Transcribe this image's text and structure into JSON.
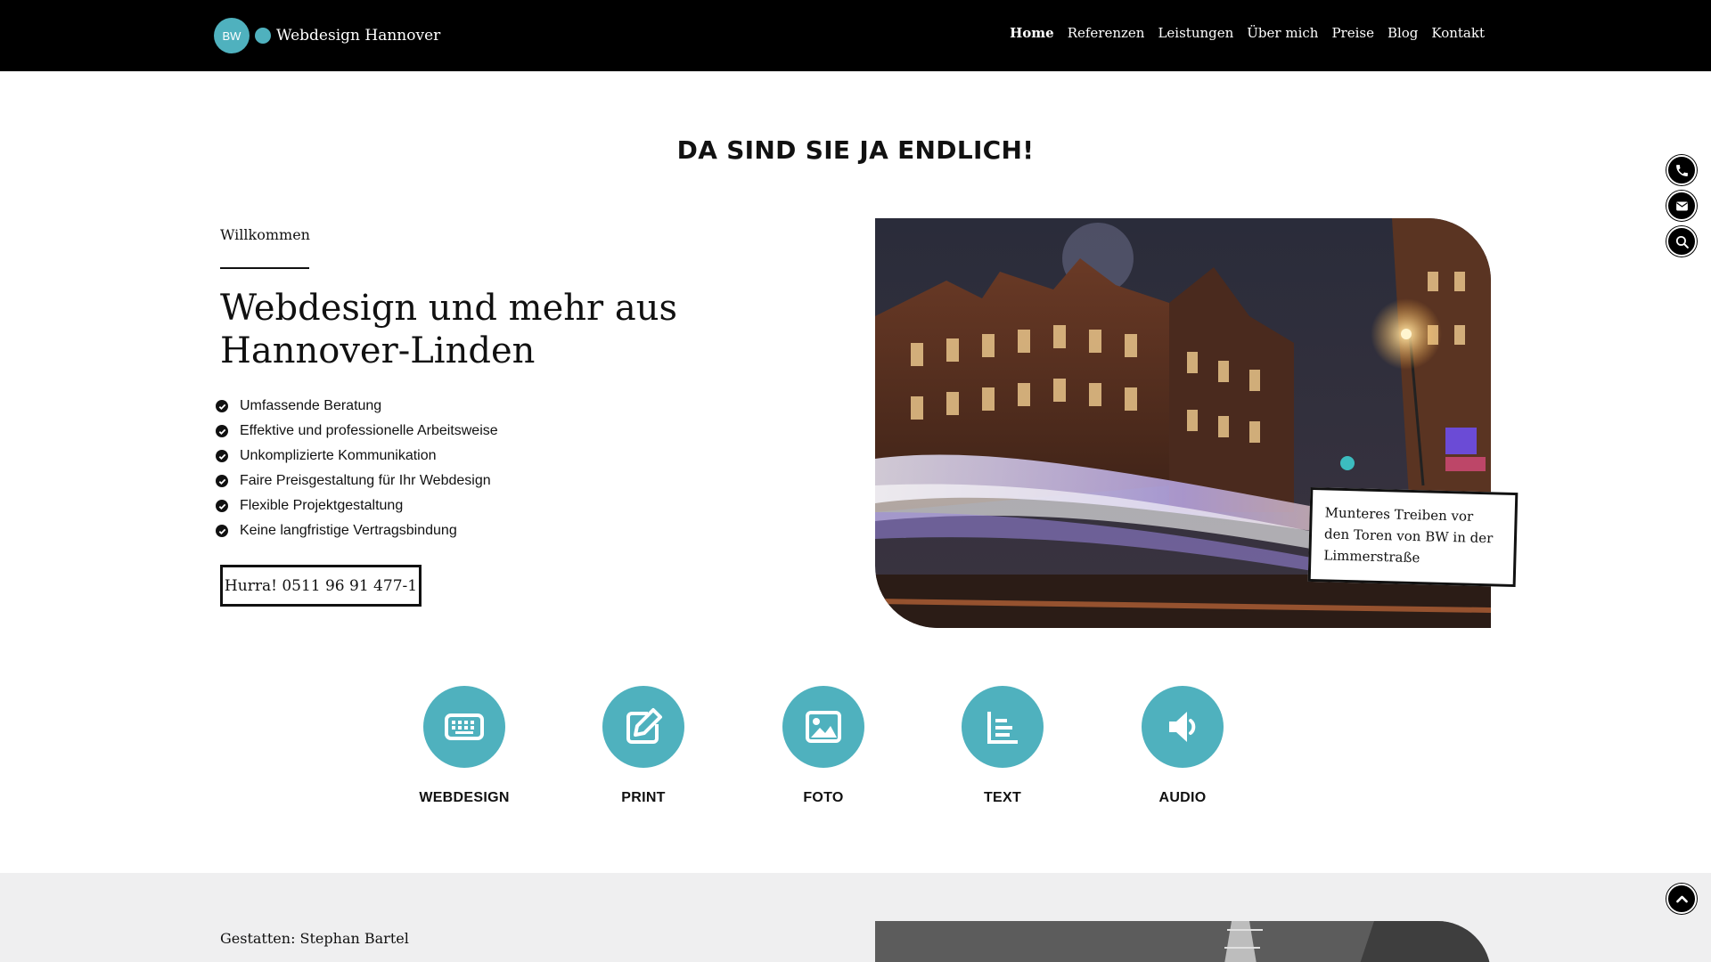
{
  "header": {
    "logo_badge": "BW",
    "logo_text": "Webdesign Hannover",
    "nav": [
      "Home",
      "Referenzen",
      "Leistungen",
      "Über mich",
      "Preise",
      "Blog",
      "Kontakt"
    ]
  },
  "side_icons": [
    "phone-icon",
    "mail-icon",
    "search-icon"
  ],
  "hero": {
    "heading": "DA SIND SIE JA ENDLICH!",
    "kicker": "Willkommen",
    "title": "Webdesign und mehr aus Hannover-Linden",
    "checklist": [
      "Umfassende Beratung",
      "Effektive und professionelle Arbeitsweise",
      "Unkomplizierte Kommunikation",
      "Faire Preisgestaltung für Ihr Webdesign",
      "Flexible Projektgestaltung",
      "Keine langfristige Vertragsbindung"
    ],
    "cta": "Hurra! 0511 96 91 477-1",
    "photo_caption": "Munteres Treiben vor den Toren von BW in der Limmerstraße"
  },
  "services": [
    {
      "label": "WEBDESIGN",
      "icon": "keyboard-icon"
    },
    {
      "label": "PRINT",
      "icon": "edit-icon"
    },
    {
      "label": "FOTO",
      "icon": "image-icon"
    },
    {
      "label": "TEXT",
      "icon": "text-icon"
    },
    {
      "label": "AUDIO",
      "icon": "speaker-icon"
    }
  ],
  "about": {
    "kicker": "Gestatten: Stephan Bartel"
  },
  "colors": {
    "accent": "#4fb1be",
    "header_bg": "#000000",
    "band_bg": "#efeff0"
  }
}
